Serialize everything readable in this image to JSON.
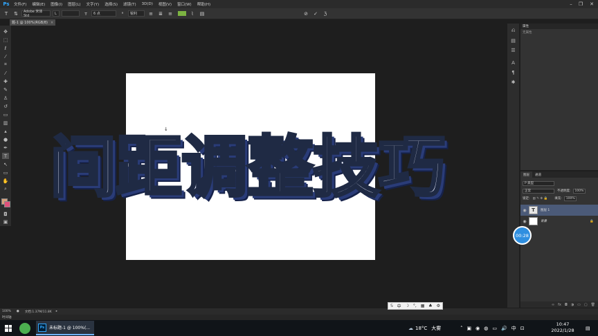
{
  "menubar": {
    "logo": "Ps",
    "items": [
      "文件(F)",
      "编辑(E)",
      "图像(I)",
      "图层(L)",
      "文字(Y)",
      "选择(S)",
      "滤镜(T)",
      "3D(D)",
      "视图(V)",
      "窗口(W)",
      "帮助(H)"
    ]
  },
  "options": {
    "font_family": "Adobe 宋体 Std",
    "font_style": "L",
    "font_size": "6 点",
    "aa_mode": "锐利",
    "color": "#7cb342"
  },
  "doc_tab": {
    "title": "题-1 @ 100%(RGB/8)",
    "close": "×"
  },
  "canvas": {
    "caption": "间距调整技巧",
    "document_bg": "#ffffff"
  },
  "properties_panel": {
    "title": "属性",
    "subtitle": "无属性"
  },
  "layers_panel": {
    "tabs": [
      "图层",
      "通道"
    ],
    "kind_label": "P 类型",
    "blend_mode": "正常",
    "opacity_label": "不透明度:",
    "opacity_value": "100%",
    "lock_label": "锁定:",
    "fill_label": "填充:",
    "fill_value": "100%",
    "layers": [
      {
        "name": "图层 1",
        "thumb": "T"
      },
      {
        "name": "背景",
        "thumb": ""
      }
    ]
  },
  "timer_badge": "00:28",
  "statusbar": {
    "zoom": "100%",
    "doc_info": "文档:1.37M/11.8K"
  },
  "timeline_label": "时间轴",
  "ime": {
    "items": [
      "中",
      "☽",
      "°,",
      "▦",
      "♣",
      "⚙"
    ]
  },
  "taskbar": {
    "ps_task_label": "未标题-1 @ 100%(...",
    "weather_temp": "18°C",
    "weather_desc": "大雾",
    "ime_lang": "中",
    "time": "10:47",
    "date": "2022/1/28"
  }
}
